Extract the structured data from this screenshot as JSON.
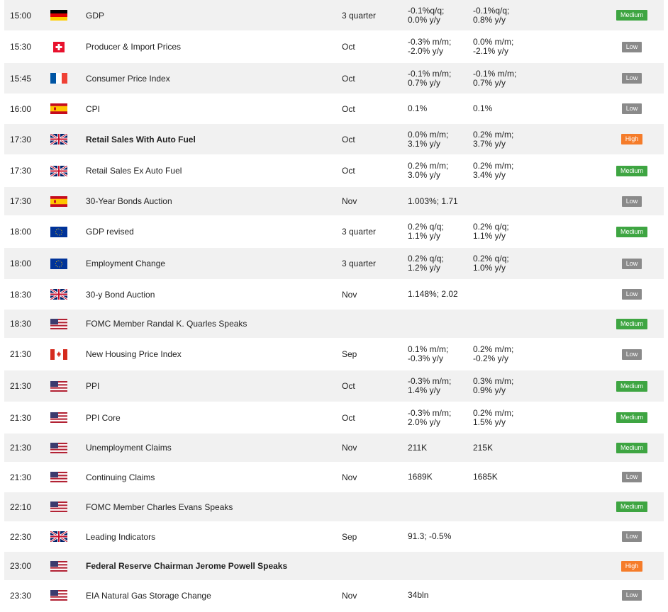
{
  "colors": {
    "row_alt": "#f1f1f1",
    "badge_high": "#f57c2a",
    "badge_medium": "#3ea542",
    "badge_low": "#8a8a8a"
  },
  "rows": [
    {
      "time": "15:00",
      "flag": "germany-flag-icon",
      "event": "GDP",
      "bold": false,
      "period": "3 quarter",
      "actual": "-0.1%q/q;\n0.0% y/y",
      "forecast": "-0.1%q/q;\n0.8% y/y",
      "impact": "Medium"
    },
    {
      "time": "15:30",
      "flag": "switzerland-flag-icon",
      "event": "Producer & Import Prices",
      "bold": false,
      "period": "Oct",
      "actual": "-0.3% m/m;\n-2.0% y/y",
      "forecast": "0.0% m/m;\n-2.1% y/y",
      "impact": "Low"
    },
    {
      "time": "15:45",
      "flag": "france-flag-icon",
      "event": "Consumer Price Index",
      "bold": false,
      "period": "Oct",
      "actual": "-0.1% m/m;\n0.7% y/y",
      "forecast": "-0.1% m/m;\n0.7% y/y",
      "impact": "Low"
    },
    {
      "time": "16:00",
      "flag": "spain-flag-icon",
      "event": "CPI",
      "bold": false,
      "period": "Oct",
      "actual": "0.1%",
      "forecast": "0.1%",
      "impact": "Low"
    },
    {
      "time": "17:30",
      "flag": "uk-flag-icon",
      "event": "Retail Sales With Auto Fuel",
      "bold": true,
      "period": "Oct",
      "actual": "0.0% m/m;\n3.1% y/y",
      "forecast": "0.2% m/m;\n3.7% y/y",
      "impact": "High"
    },
    {
      "time": "17:30",
      "flag": "uk-flag-icon",
      "event": "Retail Sales Ex Auto Fuel",
      "bold": false,
      "period": "Oct",
      "actual": "0.2% m/m;\n3.0% y/y",
      "forecast": "0.2% m/m;\n3.4% y/y",
      "impact": "Medium"
    },
    {
      "time": "17:30",
      "flag": "spain-flag-icon",
      "event": "30-Year Bonds Auction",
      "bold": false,
      "period": "Nov",
      "actual": "1.003%; 1.71",
      "forecast": "",
      "impact": "Low"
    },
    {
      "time": "18:00",
      "flag": "eu-flag-icon",
      "event": "GDP revised",
      "bold": false,
      "period": "3 quarter",
      "actual": "0.2% q/q;\n1.1% y/y",
      "forecast": "0.2% q/q;\n1.1% y/y",
      "impact": "Medium"
    },
    {
      "time": "18:00",
      "flag": "eu-flag-icon",
      "event": "Employment Change",
      "bold": false,
      "period": "3 quarter",
      "actual": "0.2% q/q;\n1.2% y/y",
      "forecast": "0.2% q/q;\n1.0% y/y",
      "impact": "Low"
    },
    {
      "time": "18:30",
      "flag": "uk-flag-icon",
      "event": "30-y Bond Auction",
      "bold": false,
      "period": "Nov",
      "actual": "1.148%; 2.02",
      "forecast": "",
      "impact": "Low"
    },
    {
      "time": "18:30",
      "flag": "usa-flag-icon",
      "event": "FOMC Member Randal K. Quarles Speaks",
      "bold": false,
      "period": "",
      "actual": "",
      "forecast": "",
      "impact": "Medium"
    },
    {
      "time": "21:30",
      "flag": "canada-flag-icon",
      "event": "New Housing Price Index",
      "bold": false,
      "period": "Sep",
      "actual": "0.1% m/m;\n-0.3% y/y",
      "forecast": "0.2% m/m;\n-0.2% y/y",
      "impact": "Low"
    },
    {
      "time": "21:30",
      "flag": "usa-flag-icon",
      "event": "PPI",
      "bold": false,
      "period": "Oct",
      "actual": "-0.3% m/m;\n1.4% y/y",
      "forecast": "0.3% m/m;\n0.9% y/y",
      "impact": "Medium"
    },
    {
      "time": "21:30",
      "flag": "usa-flag-icon",
      "event": "PPI Core",
      "bold": false,
      "period": "Oct",
      "actual": "-0.3% m/m;\n2.0% y/y",
      "forecast": "0.2% m/m;\n1.5% y/y",
      "impact": "Medium"
    },
    {
      "time": "21:30",
      "flag": "usa-flag-icon",
      "event": "Unemployment Claims",
      "bold": false,
      "period": "Nov",
      "actual": "211K",
      "forecast": "215K",
      "impact": "Medium"
    },
    {
      "time": "21:30",
      "flag": "usa-flag-icon",
      "event": "Continuing Claims",
      "bold": false,
      "period": "Nov",
      "actual": "1689K",
      "forecast": "1685K",
      "impact": "Low"
    },
    {
      "time": "22:10",
      "flag": "usa-flag-icon",
      "event": "FOMC Member Charles Evans Speaks",
      "bold": false,
      "period": "",
      "actual": "",
      "forecast": "",
      "impact": "Medium"
    },
    {
      "time": "22:30",
      "flag": "uk-flag-icon",
      "event": "Leading Indicators",
      "bold": false,
      "period": "Sep",
      "actual": "91.3; -0.5%",
      "forecast": "",
      "impact": "Low"
    },
    {
      "time": "23:00",
      "flag": "usa-flag-icon",
      "event": "Federal Reserve Chairman Jerome Powell Speaks",
      "bold": true,
      "period": "",
      "actual": "",
      "forecast": "",
      "impact": "High"
    },
    {
      "time": "23:30",
      "flag": "usa-flag-icon",
      "event": "EIA Natural Gas Storage Change",
      "bold": false,
      "period": "Nov",
      "actual": "34bln",
      "forecast": "",
      "impact": "Low"
    }
  ]
}
